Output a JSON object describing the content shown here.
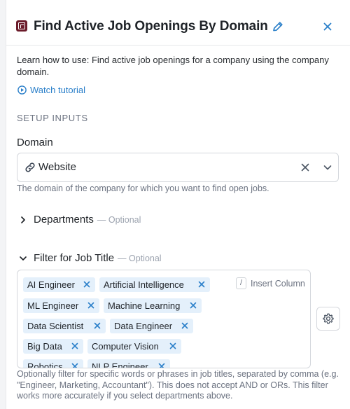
{
  "header": {
    "title": "Find Active Job Openings By Domain",
    "accent": "#6b1b2a",
    "icons": [
      "app-logo-icon",
      "pencil-icon",
      "close-icon"
    ]
  },
  "learn": {
    "prefix": "Learn how to use",
    "text": ": Find active job openings for a company using the company domain.",
    "watch_label": "Watch tutorial",
    "link_color": "#2a7fc9"
  },
  "setup": {
    "label": "SETUP INPUTS",
    "domain": {
      "label": "Domain",
      "value": "Website",
      "help": "The domain of the company for which you want to find open jobs."
    },
    "departments": {
      "label": "Departments",
      "optional": "— Optional"
    },
    "filter": {
      "label": "Filter for Job Title",
      "optional": "— Optional",
      "insert_key": "/",
      "insert_label": "Insert Column",
      "tags": [
        "AI Engineer",
        "Artificial Intelligence",
        "ML Engineer",
        "Machine Learning",
        "Data Scientist",
        "Data Engineer",
        "Big Data",
        "Computer Vision",
        "Robotics",
        "NLP Engineer"
      ],
      "help": "Optionally filter for specific words or phrases in job titles, separated by comma (e.g. \"Engineer, Marketing, Accountant\"). This does not accept AND or ORs. This filter works more accurately if you select departments above."
    }
  }
}
